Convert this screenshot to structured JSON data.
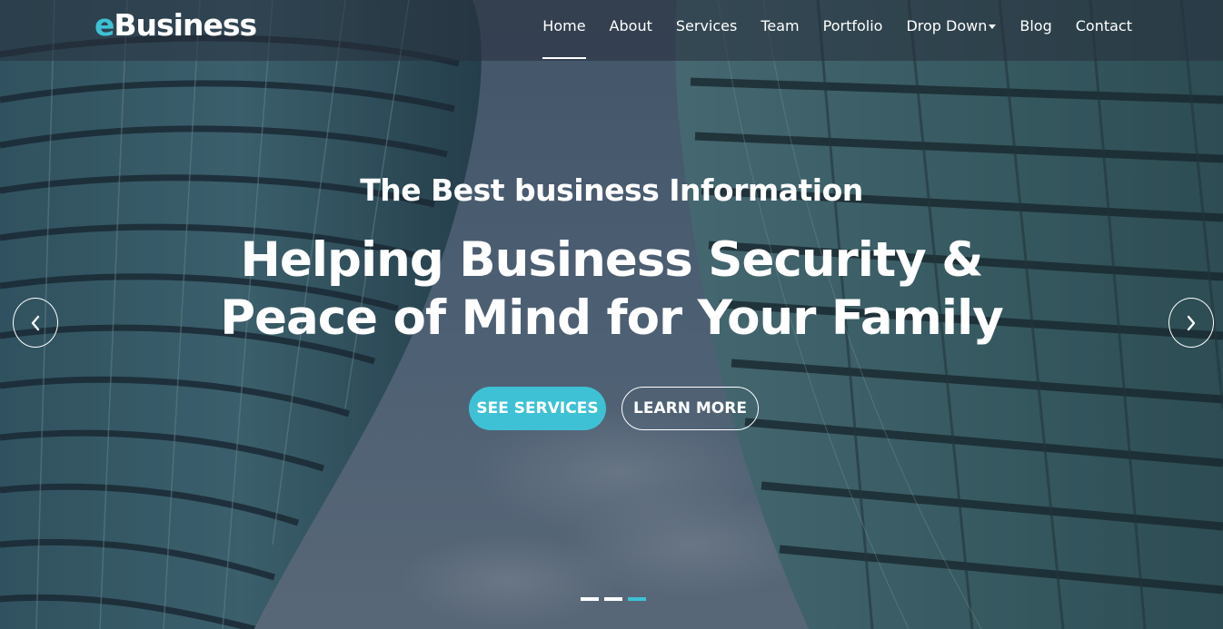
{
  "theme": {
    "accent": "#3ec1d5"
  },
  "brand": {
    "logo_prefix": "e",
    "logo_rest": "Business"
  },
  "nav": {
    "items": [
      {
        "label": "Home",
        "active": true
      },
      {
        "label": "About",
        "active": false
      },
      {
        "label": "Services",
        "active": false
      },
      {
        "label": "Team",
        "active": false
      },
      {
        "label": "Portfolio",
        "active": false
      },
      {
        "label": "Drop Down",
        "active": false,
        "has_dropdown": true
      },
      {
        "label": "Blog",
        "active": false
      },
      {
        "label": "Contact",
        "active": false
      }
    ]
  },
  "hero": {
    "subtitle": "The Best business Information",
    "title": "Helping Business Security & Peace of Mind for Your Family",
    "primary_button": "SEE SERVICES",
    "secondary_button": "LEARN MORE"
  },
  "carousel": {
    "prev_icon": "chevron-left-icon",
    "next_icon": "chevron-right-icon",
    "slide_count": 3,
    "active_slide": 3
  }
}
